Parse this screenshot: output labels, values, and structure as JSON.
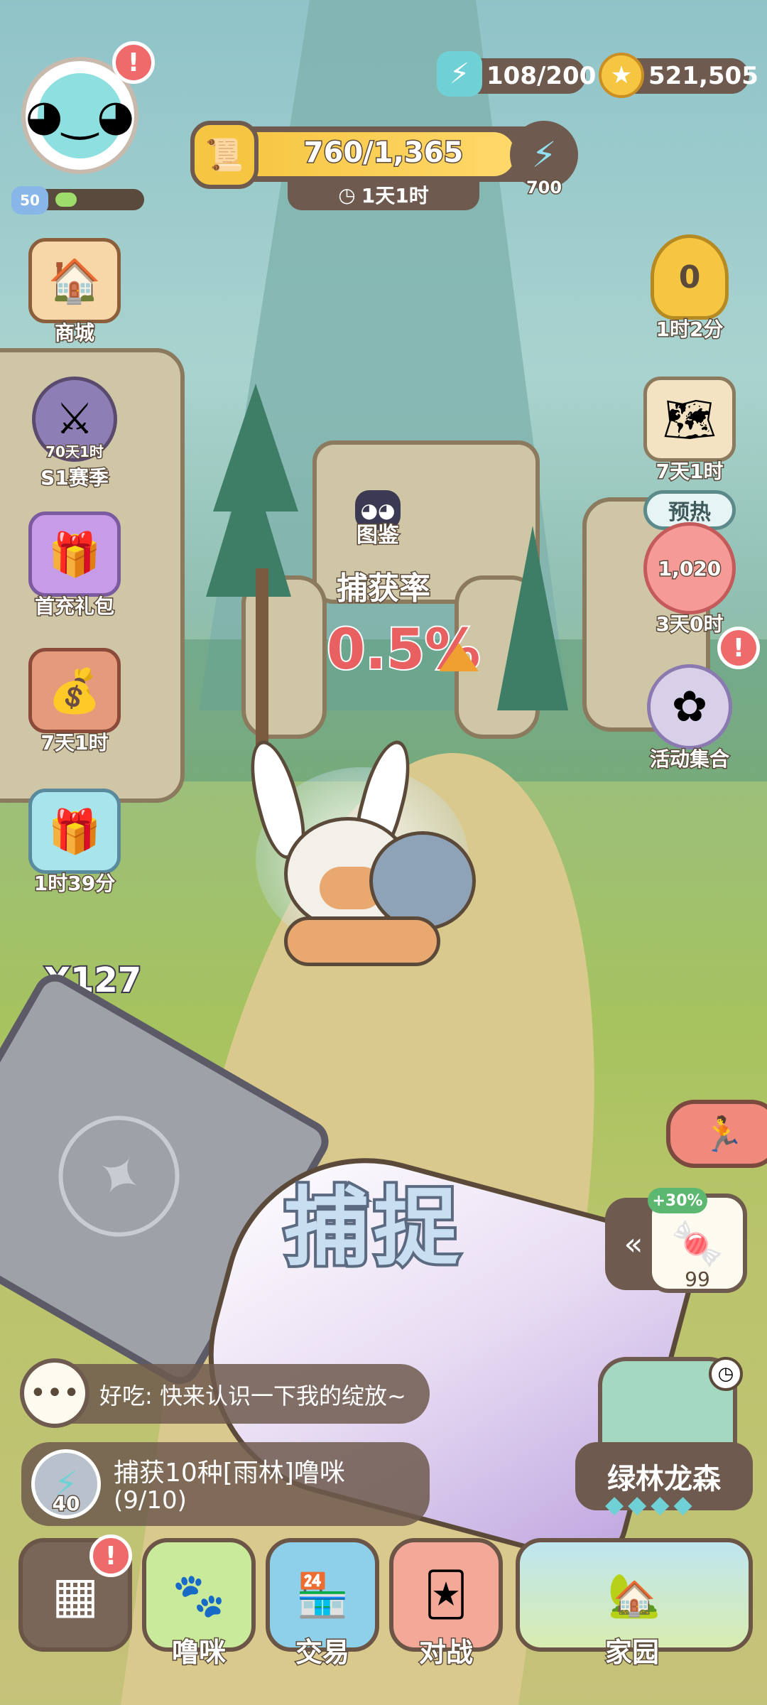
{
  "hud": {
    "level": "50",
    "energy": "108/200",
    "coins": "521,505",
    "pass_progress": "760/1,365",
    "pass_timer": "1天1时",
    "pass_reward": "700"
  },
  "left_menu": {
    "shop_label": "商城",
    "season_timer": "70天1时",
    "season_label": "S1赛季",
    "first_pack_label": "首充礼包",
    "treasure_timer": "7天1时",
    "gift_timer": "1时39分"
  },
  "right_menu": {
    "trophy_count": "0",
    "trophy_timer": "1时2分",
    "map_timer": "7天1时",
    "preheat_label": "预热",
    "preheat_value": "1,020",
    "preheat_timer": "3天0时",
    "events_label": "活动集合"
  },
  "catch": {
    "dex_label": "图鉴",
    "rate_label": "捕获率",
    "rate_value": "0.5%",
    "card_count": "X127",
    "catch_button": "捕捉",
    "candy_bonus": "+30%",
    "candy_count": "99"
  },
  "chat": {
    "message": "好吃: 快来认识一下我的绽放~"
  },
  "quest": {
    "reward": "40",
    "line1": "捕获10种[雨林]噜咪",
    "line2": "(9/10)"
  },
  "area": {
    "name": "绿林龙森"
  },
  "nav": {
    "lumi": "噜咪",
    "trade": "交易",
    "battle": "对战",
    "home": "家园"
  },
  "colors": {
    "accent_gold": "#f6c642",
    "alert_red": "#ef6a6a",
    "rate_red": "#e86060",
    "panel_brown": "#6e5a4e"
  }
}
